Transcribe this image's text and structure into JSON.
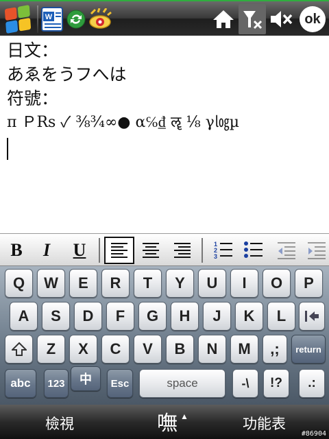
{
  "statusbar": {
    "ok_label": "ok"
  },
  "document": {
    "lines": [
      "日文：",
      "あゑをうフへは",
      "符號：",
      "π ＰRs ✓ ⅜¾∞● α℅₫ ॡ ⅛ γ㏒µ"
    ]
  },
  "format_toolbar": {
    "bold": "B",
    "italic": "I",
    "underline": "U"
  },
  "keyboard": {
    "row1": [
      "Q",
      "W",
      "E",
      "R",
      "T",
      "Y",
      "U",
      "I",
      "O",
      "P"
    ],
    "row2": [
      "A",
      "S",
      "D",
      "F",
      "G",
      "H",
      "J",
      "K",
      "L"
    ],
    "row3": [
      "Z",
      "X",
      "C",
      "V",
      "B",
      "N",
      "M",
      ",;"
    ],
    "return_label": "return",
    "abc_label": "abc",
    "num_label": "123",
    "chinese_label": "中",
    "esc_label": "Esc",
    "space_label": "space",
    "dash_key": "-\\",
    "excl_key": "!?",
    "dot_key": ".:"
  },
  "softkeys": {
    "left": "檢視",
    "ime": "嘸",
    "right": "功能表"
  },
  "watermark": "#86904",
  "colors": {
    "accent_green": "#2fae3e",
    "keyboard_top": "#a7b3bf",
    "keyboard_bottom": "#4b5866"
  }
}
